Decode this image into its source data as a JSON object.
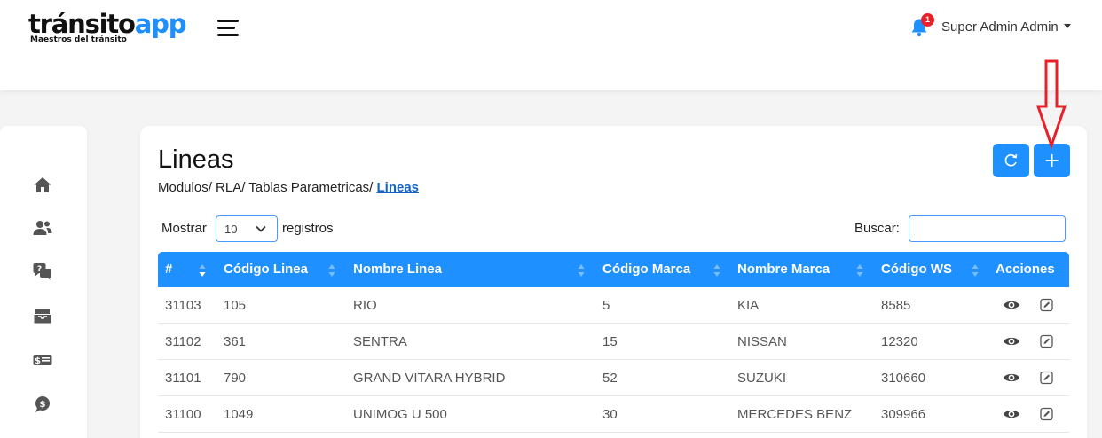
{
  "header": {
    "logo": {
      "part1": "tránsito",
      "part2": "app",
      "tagline": "Maestros del tránsito"
    },
    "notifications": {
      "count": "1"
    },
    "user": {
      "name": "Super Admin Admin"
    }
  },
  "colors": {
    "primary": "#1e90ff",
    "badge": "#e8202a",
    "arrow": "#e8202a"
  },
  "sidebar": {
    "icons": [
      "home-icon",
      "users-icon",
      "question-chat-icon",
      "inbox-icon",
      "money-bill-icon",
      "dollar-comment-icon"
    ]
  },
  "page": {
    "title": "Lineas",
    "breadcrumb": {
      "trail": "Modulos/ RLA/ Tablas Parametricas/ ",
      "current": "Lineas"
    },
    "buttons": {
      "refresh_icon": "refresh-icon",
      "add_label": "+"
    }
  },
  "table_controls": {
    "show_label": "Mostrar",
    "page_size": "10",
    "show_suffix": "registros",
    "search_label": "Buscar:",
    "search_value": ""
  },
  "table": {
    "columns": [
      "#",
      "Código Linea",
      "Nombre Linea",
      "Código Marca",
      "Nombre Marca",
      "Código WS",
      "Acciones"
    ],
    "rows": [
      [
        "31103",
        "105",
        "RIO",
        "5",
        "KIA",
        "8585"
      ],
      [
        "31102",
        "361",
        "SENTRA",
        "15",
        "NISSAN",
        "12320"
      ],
      [
        "31101",
        "790",
        "GRAND VITARA HYBRID",
        "52",
        "SUZUKI",
        "310660"
      ],
      [
        "31100",
        "1049",
        "UNIMOG U 500",
        "30",
        "MERCEDES BENZ",
        "309966"
      ]
    ]
  }
}
